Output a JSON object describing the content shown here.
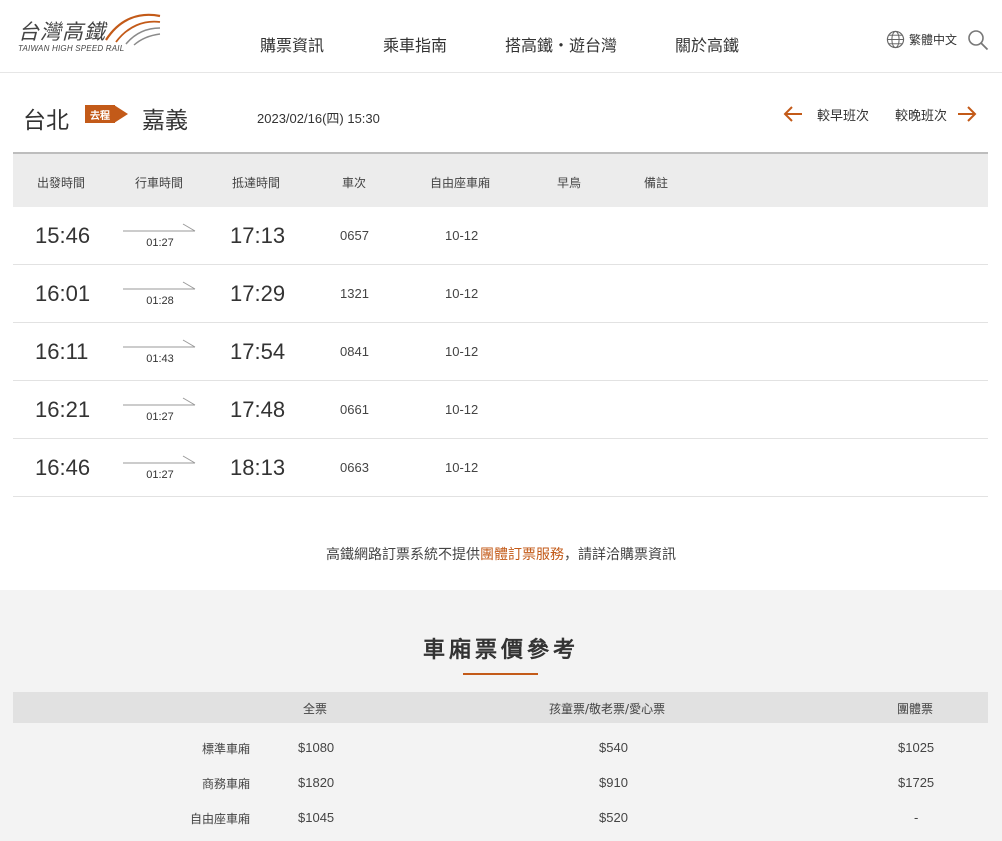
{
  "header": {
    "logo_zh": "台灣高鐵",
    "logo_en": "TAIWAN HIGH SPEED RAIL",
    "nav": [
      "購票資訊",
      "乘車指南",
      "搭高鐵・遊台灣",
      "關於高鐵"
    ],
    "language": "繁體中文",
    "search_icon": "search-icon",
    "globe_icon": "globe-icon"
  },
  "route": {
    "from": "台北",
    "to": "嘉義",
    "direction_tag": "去程",
    "datetime": "2023/02/16(四) 15:30",
    "earlier_label": "較早班次",
    "later_label": "較晚班次"
  },
  "timetable": {
    "headers": [
      "出發時間",
      "行車時間",
      "抵達時間",
      "車次",
      "自由座車廂",
      "早鳥",
      "備註"
    ],
    "rows": [
      {
        "dep": "15:46",
        "duration": "01:27",
        "arr": "17:13",
        "train": "0657",
        "free_car": "10-12"
      },
      {
        "dep": "16:01",
        "duration": "01:28",
        "arr": "17:29",
        "train": "1321",
        "free_car": "10-12"
      },
      {
        "dep": "16:11",
        "duration": "01:43",
        "arr": "17:54",
        "train": "0841",
        "free_car": "10-12"
      },
      {
        "dep": "16:21",
        "duration": "01:27",
        "arr": "17:48",
        "train": "0661",
        "free_car": "10-12"
      },
      {
        "dep": "16:46",
        "duration": "01:27",
        "arr": "18:13",
        "train": "0663",
        "free_car": "10-12"
      }
    ]
  },
  "notice": {
    "prefix": "高鐵網路訂票系統不提供",
    "link": "團體訂票服務",
    "suffix": "，請詳洽購票資訊"
  },
  "fare": {
    "title": "車廂票價參考",
    "headers": [
      "全票",
      "孩童票/敬老票/愛心票",
      "團體票"
    ],
    "rows": [
      {
        "label": "標準車廂",
        "full": "$1080",
        "concession": "$540",
        "group": "$1025"
      },
      {
        "label": "商務車廂",
        "full": "$1820",
        "concession": "$910",
        "group": "$1725"
      },
      {
        "label": "自由座車廂",
        "full": "$1045",
        "concession": "$520",
        "group": "-"
      }
    ]
  },
  "colors": {
    "accent": "#c35a18",
    "text": "#333333",
    "table_header_bg": "#ececec",
    "fare_bg": "#f3f3f3"
  }
}
